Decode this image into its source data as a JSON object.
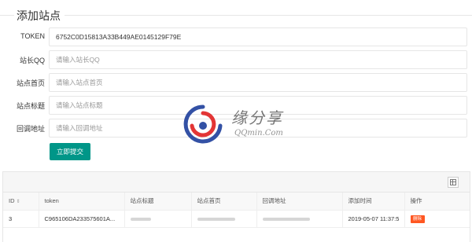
{
  "page": {
    "section_title": "添加站点"
  },
  "form": {
    "token": {
      "label": "TOKEN",
      "value": "6752C0D15813A33B449AE0145129F79E",
      "placeholder": ""
    },
    "qq": {
      "label": "站长QQ",
      "value": "",
      "placeholder": "请输入站长QQ"
    },
    "homepage": {
      "label": "站点首页",
      "value": "",
      "placeholder": "请输入站点首页"
    },
    "site_title": {
      "label": "站点标题",
      "value": "",
      "placeholder": "请输入站点标题"
    },
    "callback": {
      "label": "回调地址",
      "value": "",
      "placeholder": "请输入回调地址"
    },
    "submit_label": "立即提交"
  },
  "table": {
    "toolbar_icon": "filter-columns-icon",
    "headers": {
      "id": "ID",
      "token": "token",
      "site_title": "站点标题",
      "homepage": "站点首页",
      "callback": "回调地址",
      "added_time": "添加时间",
      "actions": "操作"
    },
    "rows": [
      {
        "id": "3",
        "token": "C965106DA233575601A...",
        "added_time": "2019-05-07 11:37:5",
        "delete_label": "删除"
      }
    ]
  },
  "watermark": {
    "text": "缘分享",
    "sub": "QQmin.Com",
    "colors": {
      "red": "#e02020",
      "blue": "#1e3f9c"
    }
  }
}
